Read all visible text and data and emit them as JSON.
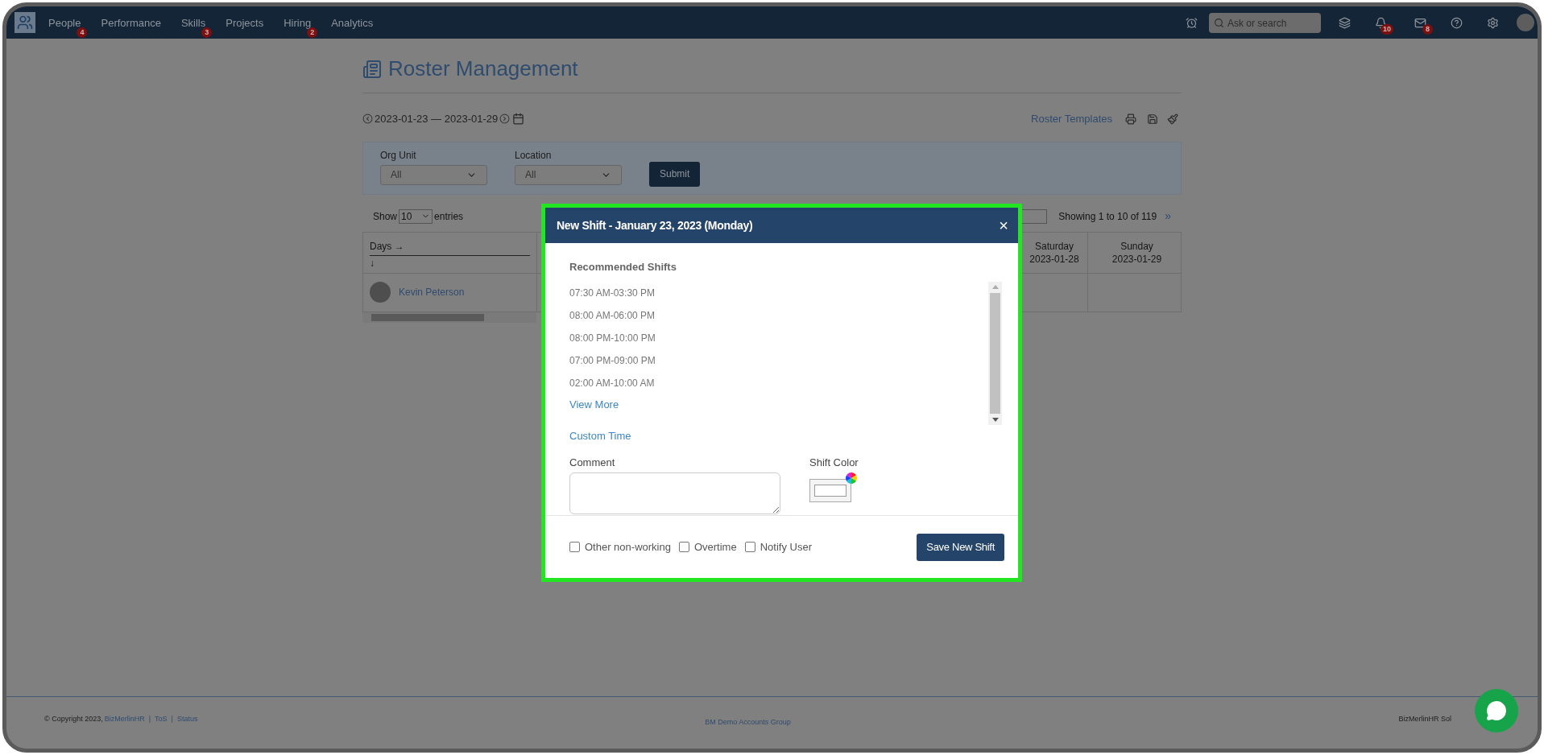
{
  "nav": {
    "items": [
      {
        "label": "People",
        "badge": "4"
      },
      {
        "label": "Performance"
      },
      {
        "label": "Skills",
        "badge": "3"
      },
      {
        "label": "Projects"
      },
      {
        "label": "Hiring",
        "badge": "2"
      },
      {
        "label": "Analytics"
      }
    ],
    "search": {
      "placeholder": "Ask or search"
    },
    "notifications_badge": "10",
    "messages_badge": "8"
  },
  "page": {
    "title": "Roster Management",
    "date_range": "2023-01-23 — 2023-01-29",
    "templates_link": "Roster Templates",
    "filters": [
      {
        "label": "Org Unit",
        "value": "All"
      },
      {
        "label": "Location",
        "value": "All"
      }
    ],
    "submit": "Submit",
    "entries": {
      "prefix": "Show",
      "value": "10",
      "suffix": "entries"
    },
    "showing": "Showing 1 to 10 of 119",
    "next": "»",
    "table": {
      "days_header": "Days →",
      "days_sub": "↓",
      "columns": [
        {
          "day": "Saturday",
          "date": "2023-01-28"
        },
        {
          "day": "Sunday",
          "date": "2023-01-29"
        }
      ],
      "rows": [
        {
          "name": "Kevin Peterson"
        }
      ]
    }
  },
  "modal": {
    "title": "New Shift - January 23, 2023 (Monday)",
    "close": "×",
    "recommended_label": "Recommended Shifts",
    "shifts": [
      "07:30 AM-03:30 PM",
      "08:00 AM-06:00 PM",
      "08:00 PM-10:00 PM",
      "07:00 PM-09:00 PM",
      "02:00 AM-10:00 AM"
    ],
    "view_more": "View More",
    "custom_time": "Custom Time",
    "comment_label": "Comment",
    "shift_color_label": "Shift Color",
    "options": [
      {
        "label": "Other non-working",
        "checked": false
      },
      {
        "label": "Overtime",
        "checked": false
      },
      {
        "label": "Notify User",
        "checked": false
      }
    ],
    "save": "Save New Shift"
  },
  "footer": {
    "copyright": "© Copyright 2023,",
    "brand_link": "BizMerlinHR",
    "links": [
      "ToS",
      "Status"
    ],
    "separator": "|",
    "center": "BM Demo Accounts Group",
    "right": "BizMerlinHR Sol"
  }
}
